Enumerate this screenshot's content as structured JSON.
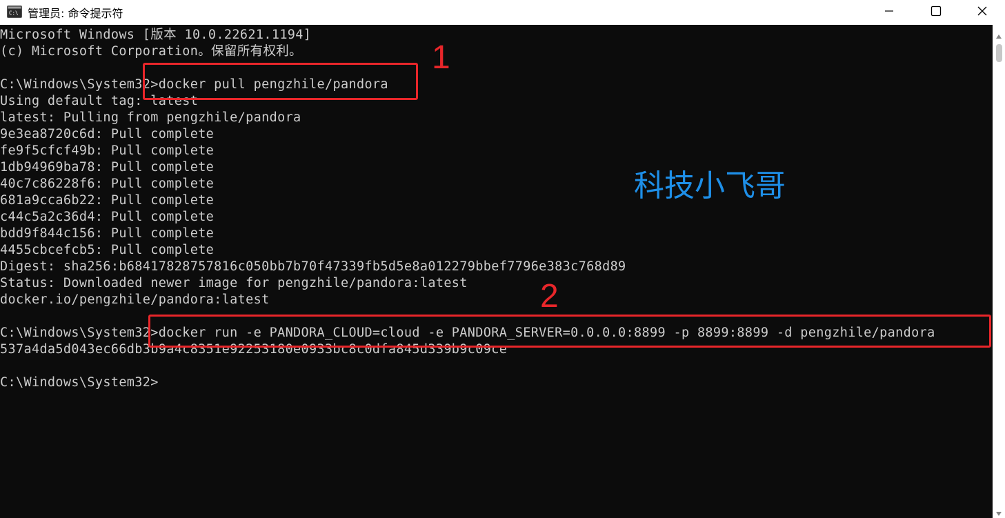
{
  "window": {
    "title": "管理员: 命令提示符",
    "icon": "cmd-icon",
    "controls": {
      "minimize": "minimize-icon",
      "maximize": "maximize-icon",
      "close": "close-icon"
    }
  },
  "console": {
    "lines": [
      "Microsoft Windows [版本 10.0.22621.1194]",
      "(c) Microsoft Corporation。保留所有权利。",
      "",
      "C:\\Windows\\System32>docker pull pengzhile/pandora",
      "Using default tag: latest",
      "latest: Pulling from pengzhile/pandora",
      "9e3ea8720c6d: Pull complete",
      "fe9f5cfcf49b: Pull complete",
      "1db94969ba78: Pull complete",
      "40c7c86228f6: Pull complete",
      "681a9cca6b22: Pull complete",
      "c44c5a2c36d4: Pull complete",
      "bdd9f844c156: Pull complete",
      "4455cbcefcb5: Pull complete",
      "Digest: sha256:b68417828757816c050bb7b70f47339fb5d5e8a012279bbef7796e383c768d89",
      "Status: Downloaded newer image for pengzhile/pandora:latest",
      "docker.io/pengzhile/pandora:latest",
      "",
      "C:\\Windows\\System32>docker run -e PANDORA_CLOUD=cloud -e PANDORA_SERVER=0.0.0.0:8899 -p 8899:8899 -d pengzhile/pandora",
      "537a4da5d043ec66db3b9a4c8351e92253180e0933bc8c0dfa845d339b9c09ce",
      "",
      "C:\\Windows\\System32>"
    ]
  },
  "annotations": {
    "step1_label": "1",
    "step2_label": "2",
    "watermark": "科技小飞哥",
    "highlight_color": "#e8262a",
    "watermark_color": "#1e8fe8"
  },
  "colors": {
    "console_background": "#0c0c0c",
    "console_text": "#cccccc",
    "titlebar_background": "#ffffff"
  }
}
